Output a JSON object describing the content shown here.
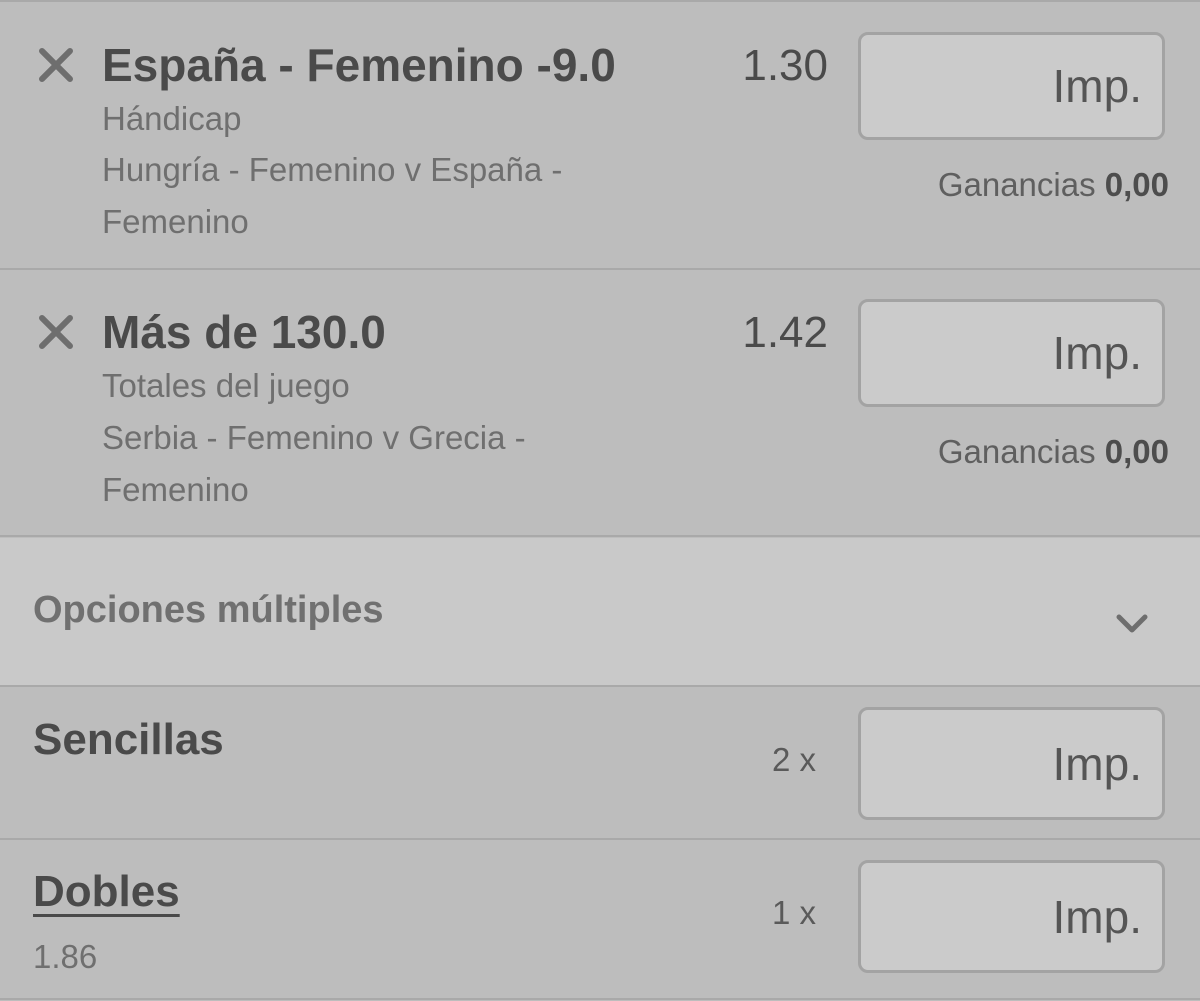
{
  "selections": [
    {
      "title": "España - Femenino -9.0",
      "market": "Hándicap",
      "event": "Hungría - Femenino v España - Femenino",
      "odds": "1.30",
      "stake_placeholder": "Imp.",
      "winnings_label": "Ganancias",
      "winnings_value": "0,00",
      "remove_icon": "close-icon"
    },
    {
      "title": "Más de 130.0",
      "market": "Totales del juego",
      "event": "Serbia - Femenino v Grecia - Femenino",
      "odds": "1.42",
      "stake_placeholder": "Imp.",
      "winnings_label": "Ganancias",
      "winnings_value": "0,00",
      "remove_icon": "close-icon"
    }
  ],
  "multiples": {
    "label": "Opciones múltiples",
    "icon": "chevron-down-icon"
  },
  "singles": {
    "label": "Sencillas",
    "multiplier": "2 x",
    "stake_placeholder": "Imp."
  },
  "doubles": {
    "label": "Dobles",
    "odds": "1.86",
    "multiplier": "1 x",
    "stake_placeholder": "Imp."
  }
}
